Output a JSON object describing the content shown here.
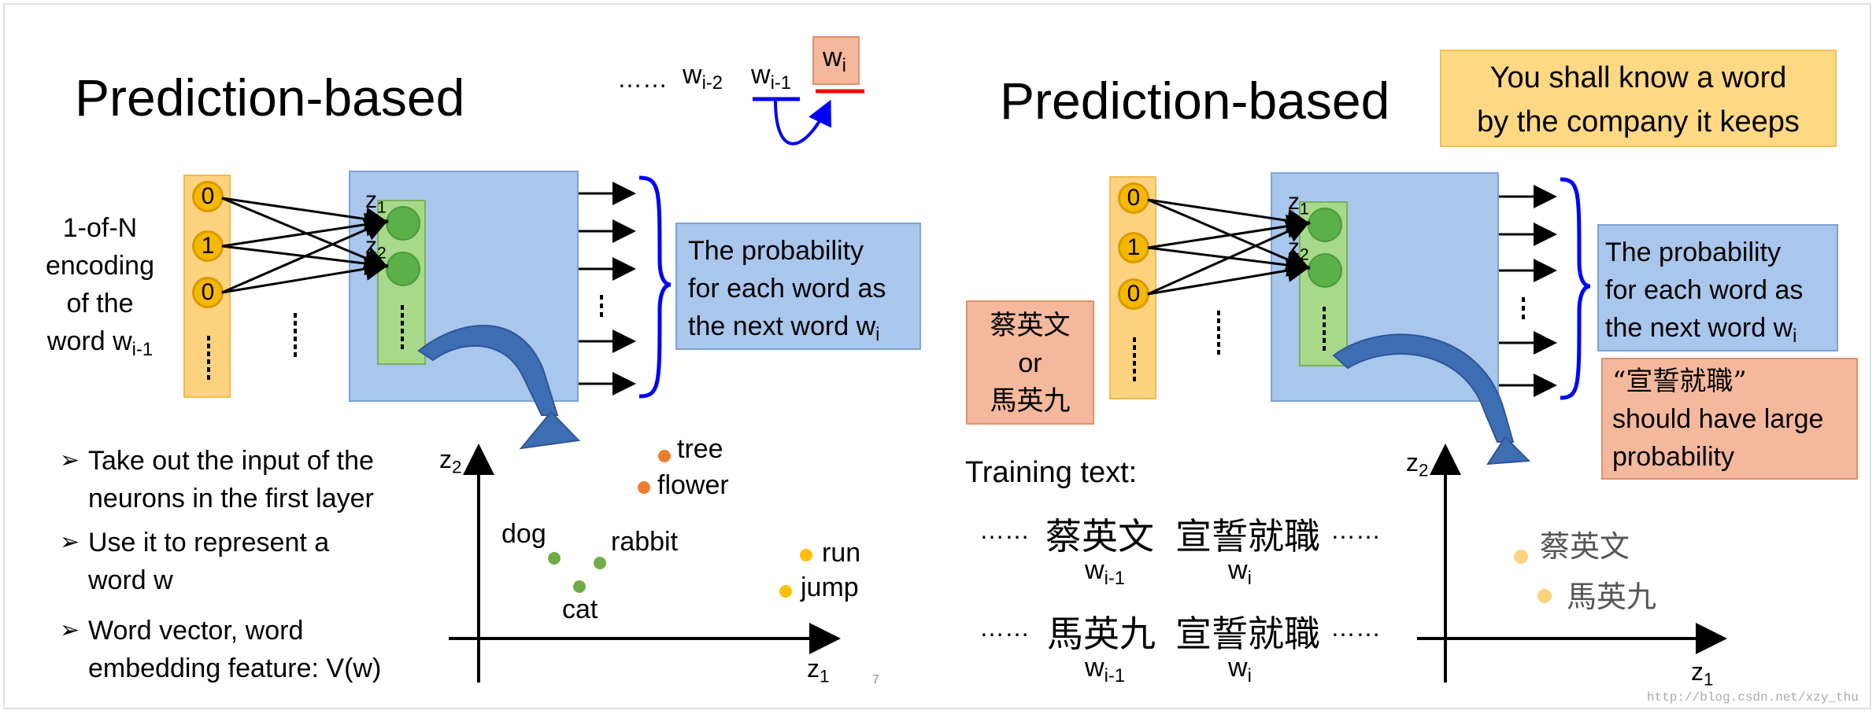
{
  "left_panel": {
    "title": "Prediction-based",
    "sequence": {
      "dots": "……",
      "w": "w",
      "sub_im2": "i-2",
      "sub_im1": "i-1",
      "sub_i": "i"
    },
    "input_label": {
      "line1": "1-of-N",
      "line2": "encoding",
      "line3": "of the",
      "line4_main": "word w",
      "line4_sub": "i-1"
    },
    "input_values": [
      "0",
      "1",
      "0"
    ],
    "z_labels": {
      "z": "z",
      "sub1": "1",
      "sub2": "2"
    },
    "prob_box": {
      "line1": "The probability",
      "line2": "for each word as",
      "line3_main": "the next word w",
      "line3_sub": "i"
    },
    "bullets": [
      {
        "line1": "Take out the input of the",
        "line2": "neurons in the first layer"
      },
      {
        "line1": "Use it to represent a",
        "line2": "word w"
      },
      {
        "line1": "Word vector, word",
        "line2": "embedding feature: V(w)"
      }
    ],
    "bullet_symbol": "➢",
    "plot": {
      "y_axis_main": "z",
      "y_axis_sub": "2",
      "x_axis_main": "z",
      "x_axis_sub": "1",
      "points": [
        {
          "label": "tree",
          "color": "#ed7d31"
        },
        {
          "label": "flower",
          "color": "#ed7d31"
        },
        {
          "label": "dog",
          "color": "#70ad47"
        },
        {
          "label": "rabbit",
          "color": "#70ad47"
        },
        {
          "label": "cat",
          "color": "#70ad47"
        },
        {
          "label": "run",
          "color": "#ffc000"
        },
        {
          "label": "jump",
          "color": "#ffc000"
        }
      ]
    },
    "page_number": "7"
  },
  "right_panel": {
    "title": "Prediction-based",
    "quote_box": {
      "line1": "You shall know a word",
      "line2": "by the company it keeps"
    },
    "name_box": {
      "line1": "蔡英文",
      "line2": "or",
      "line3": "馬英九"
    },
    "input_values": [
      "0",
      "1",
      "0"
    ],
    "prob_box": {
      "line1": "The probability",
      "line2": "for each word as",
      "line3_main": "the next word w",
      "line3_sub": "i"
    },
    "large_prob_box": {
      "line1": "“宣誓就職”",
      "line2": "should have large",
      "line3": "probability"
    },
    "training_title": "Training text:",
    "training_lines": [
      {
        "dots1": "……",
        "word1": "蔡英文",
        "word2": "宣誓就職",
        "dots2": "……",
        "label1_main": "w",
        "label1_sub": "i-1",
        "label2_main": "w",
        "label2_sub": "i"
      },
      {
        "dots1": "……",
        "word1": "馬英九",
        "word2": "宣誓就職",
        "dots2": "……",
        "label1_main": "w",
        "label1_sub": "i-1",
        "label2_main": "w",
        "label2_sub": "i"
      }
    ],
    "plot": {
      "y_axis_main": "z",
      "y_axis_sub": "2",
      "x_axis_main": "z",
      "x_axis_sub": "1",
      "points": [
        {
          "label": "蔡英文",
          "color": "#ffd27f"
        },
        {
          "label": "馬英九",
          "color": "#ffd27f"
        }
      ]
    }
  },
  "watermark": "http://blog.csdn.net/xzy_thu",
  "colors": {
    "network_blue": "#a9c6ec",
    "hidden_green": "#a8d88a",
    "input_orange": "#ffd27f",
    "bracket_blue": "#0000ff",
    "arrow_blue": "#3d6eb4",
    "red_underline": "#ff0000"
  }
}
